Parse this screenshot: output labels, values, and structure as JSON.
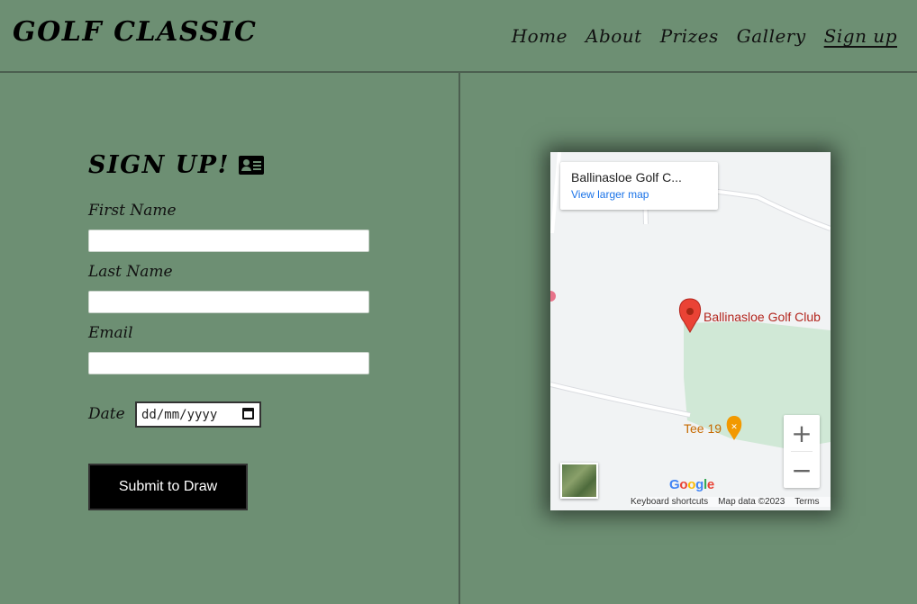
{
  "header": {
    "logo": "GOLF CLASSIC",
    "nav": [
      "Home",
      "About",
      "Prizes",
      "Gallery",
      "Sign up"
    ],
    "active_nav": "Sign up"
  },
  "form": {
    "title": "SIGN UP!",
    "title_icon": "id-card-icon",
    "first_name_label": "First Name",
    "first_name_value": "",
    "last_name_label": "Last Name",
    "last_name_value": "",
    "email_label": "Email",
    "email_value": "",
    "date_label": "Date",
    "date_placeholder": "dd/mm/yyyy",
    "submit_label": "Submit to Draw"
  },
  "map": {
    "place_title": "Ballinasloe Golf C...",
    "view_larger": "View larger map",
    "pin_label": "Ballinasloe Golf Club",
    "poi_label": "Tee 19",
    "zoom_in": "+",
    "zoom_out": "−",
    "brand": [
      "G",
      "o",
      "o",
      "g",
      "l",
      "e"
    ],
    "brand_colors": [
      "#4285f4",
      "#ea4335",
      "#fbbc05",
      "#4285f4",
      "#34a853",
      "#ea4335"
    ],
    "attribution": [
      "Keyboard shortcuts",
      "Map data ©2023",
      "Terms"
    ]
  },
  "colors": {
    "background": "#6d8f73",
    "button": "#000000",
    "golf_area": "#d0e8d6",
    "pin": "#ea4335"
  }
}
